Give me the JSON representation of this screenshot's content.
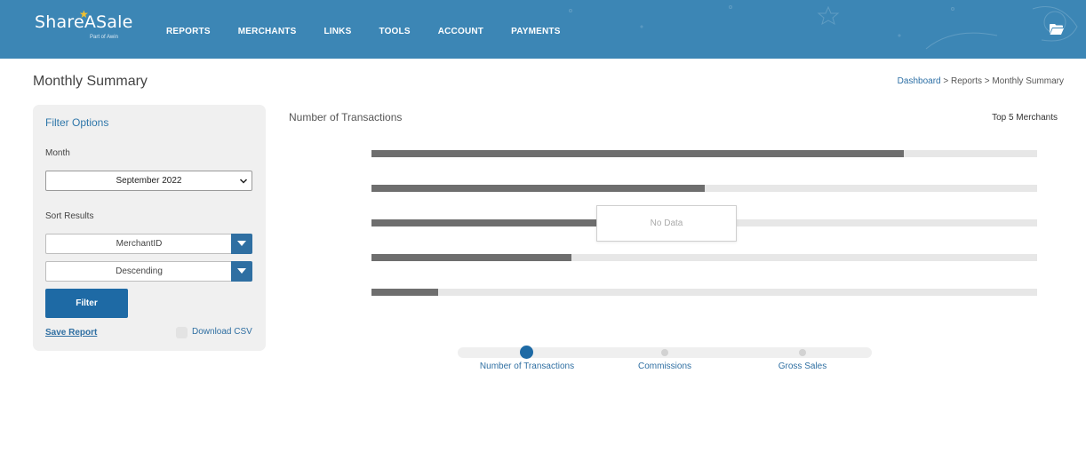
{
  "brand": {
    "logo_text": "ShareASale",
    "logo_sub": "Part of Awin",
    "star": "★",
    "accent_color": "#3c86b5"
  },
  "nav": {
    "items": [
      "REPORTS",
      "MERCHANTS",
      "LINKS",
      "TOOLS",
      "ACCOUNT",
      "PAYMENTS"
    ],
    "folder_icon": "folder-icon"
  },
  "page": {
    "title": "Monthly Summary",
    "breadcrumb": {
      "link": "Dashboard",
      "sep": ">",
      "mid": "Reports",
      "current": "Monthly Summary"
    }
  },
  "filter": {
    "title": "Filter Options",
    "month_label": "Month",
    "month_value": "September 2022",
    "sort_label": "Sort Results",
    "sort_by_value": "MerchantID",
    "sort_order_value": "Descending",
    "filter_button": "Filter",
    "save_report": "Save Report",
    "download_csv": "Download CSV"
  },
  "chart": {
    "title": "Number of Transactions",
    "side_label": "Top 5 Merchants",
    "no_data_text": "No Data",
    "bar_fill_fractions": [
      0.8,
      0.5,
      0.34,
      0.3,
      0.1
    ],
    "bar_color": "#6e6e6e",
    "track_color": "#e7e7e7"
  },
  "slider": {
    "labels": [
      "Number of Transactions",
      "Commissions",
      "Gross Sales"
    ],
    "active_index": 0,
    "active_color": "#1e6aa5"
  }
}
